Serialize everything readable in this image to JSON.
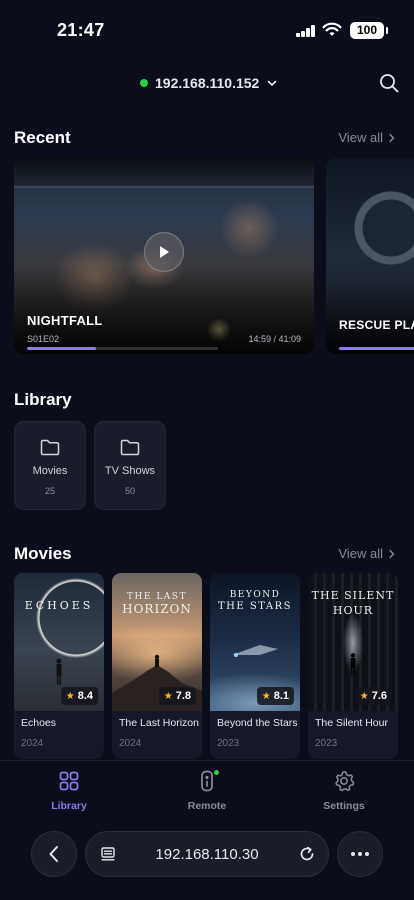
{
  "status_bar": {
    "time": "21:47",
    "battery": "100"
  },
  "header": {
    "server_ip": "192.168.110.152"
  },
  "recent": {
    "title": "Recent",
    "view_all": "View all",
    "items": [
      {
        "title": "NIGHTFALL",
        "episode": "S01E02",
        "time": "14:59 / 41:09",
        "progress": 0.36
      },
      {
        "title": "RESCUE PLAN"
      }
    ]
  },
  "library": {
    "title": "Library",
    "folders": [
      {
        "label": "Movies",
        "count": "25"
      },
      {
        "label": "TV Shows",
        "count": "50"
      }
    ]
  },
  "movies": {
    "title": "Movies",
    "view_all": "View all",
    "items": [
      {
        "poster_title": "ECHOES",
        "title": "Echoes",
        "year": "2024",
        "rating": "8.4"
      },
      {
        "poster_title_1": "THE LAST",
        "poster_title_2": "HORIZON",
        "title": "The Last Horizon",
        "year": "2024",
        "rating": "7.8"
      },
      {
        "poster_title_1": "BEYOND",
        "poster_title_2": "THE STARS",
        "title": "Beyond the Stars",
        "year": "2023",
        "rating": "8.1"
      },
      {
        "poster_title_1": "THE SILENT",
        "poster_title_2": "HOUR",
        "title": "The Silent Hour",
        "year": "2023",
        "rating": "7.6"
      }
    ]
  },
  "bottom_nav": {
    "items": [
      {
        "label": "Library",
        "icon": "grid-icon",
        "active": true
      },
      {
        "label": "Remote",
        "icon": "remote-icon",
        "active": false
      },
      {
        "label": "Settings",
        "icon": "gear-icon",
        "active": false
      }
    ]
  },
  "browser": {
    "url": "192.168.110.30"
  },
  "colors": {
    "accent": "#8a7cf0",
    "online": "#2ecc40",
    "star": "#f5b82e",
    "background": "#0c0d1a"
  }
}
